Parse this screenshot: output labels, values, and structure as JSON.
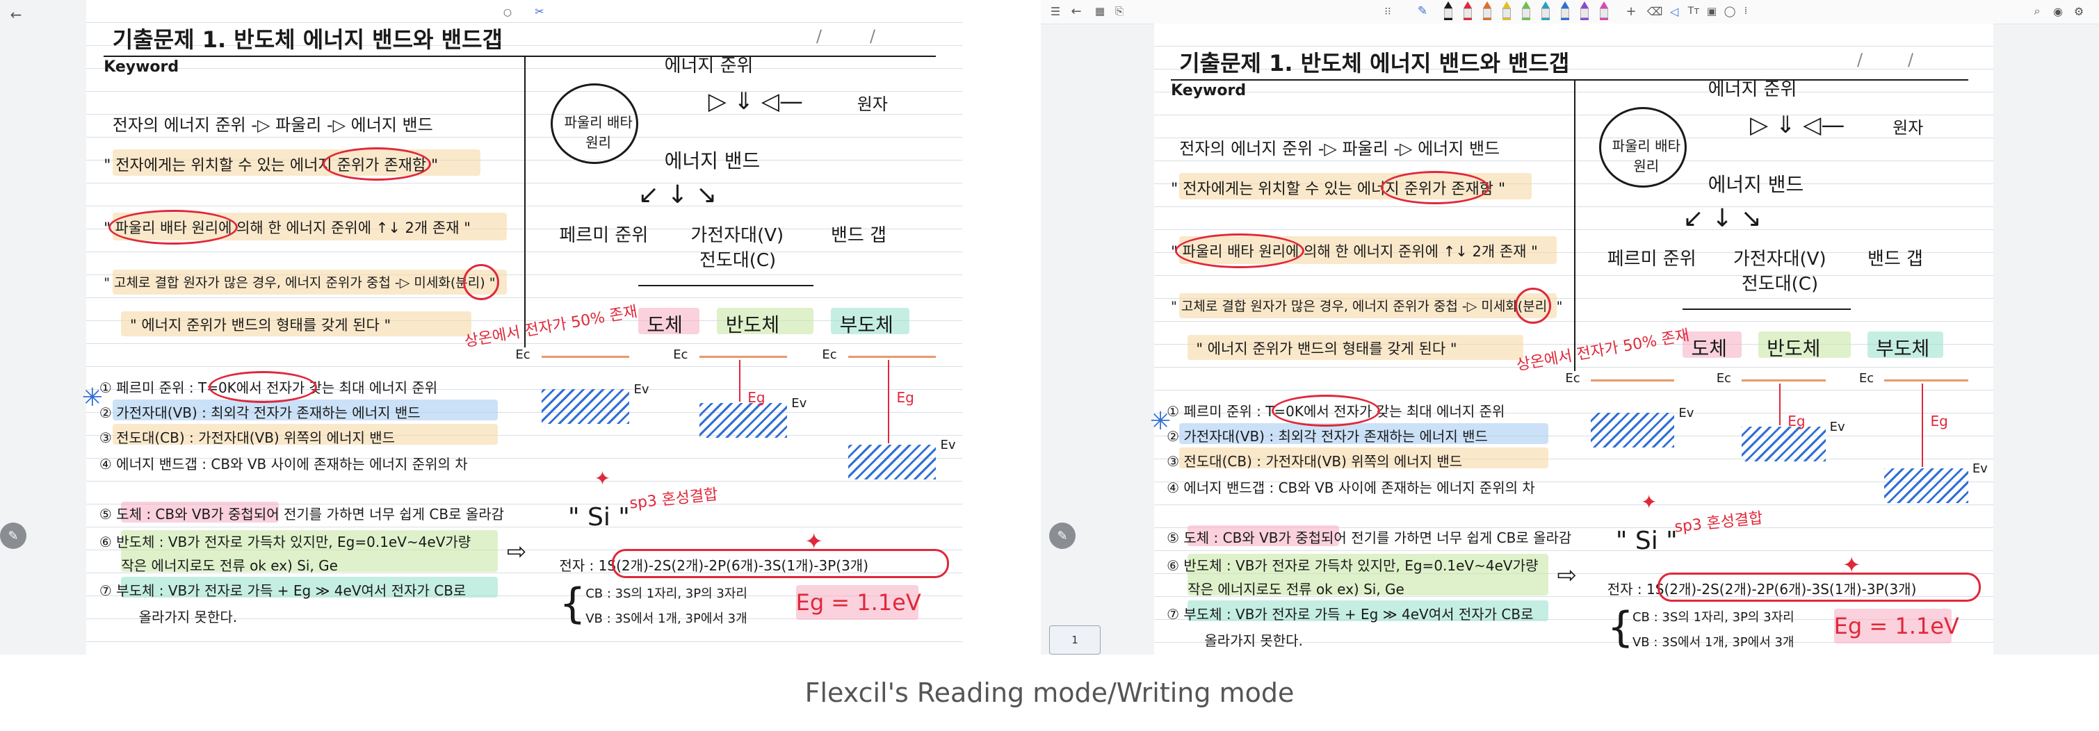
{
  "reading": {
    "pager": {
      "current": "/",
      "total": "/"
    }
  },
  "writing": {
    "pager": {
      "current": "/",
      "total": "/"
    },
    "page_number": "1"
  },
  "note": {
    "title": "기출문제 1. 반도체 에너지 밴드와 밴드갭",
    "keyword": "Keyword",
    "energy_level": "에너지 준위",
    "atom": "원자",
    "pauli": "파울리 배타원리",
    "energy_band": "에너지 밴드",
    "fermi": "페르미 준위",
    "valence_band": "가전자대(V)",
    "conduction_band": "전도대(C)",
    "band_gap": "밴드 갭",
    "line1": "전자의 에너지 준위 -▷ 파울리 -▷ 에너지 밴드",
    "line2": "\" 전자에게는 위치할 수 있는 에너지 준위가 존재함 \"",
    "line3": "\" 파울리 배타 원리에 의해 한 에너지 준위에 ↑↓ 2개 존재 \"",
    "line4": "\" 고체로 결합 원자가 많은 경우, 에너지 준위가 중첩 -▷ 미세화(분리) \"",
    "line5": "\" 에너지 준위가 밴드의 형태를 갖게 된다 \"",
    "cond": "도체",
    "semi": "반도체",
    "insul": "부도체",
    "red_note": "상온에서 전자가 50% 존재",
    "item1": "① 페르미 준위 : T=0K에서 전자가 갖는 최대 에너지 준위",
    "item2": "② 가전자대(VB) : 최외각 전자가 존재하는 에너지 밴드",
    "item3": "③ 전도대(CB) : 가전자대(VB) 위쪽의 에너지 밴드",
    "item4": "④ 에너지 밴드갭 : CB와 VB 사이에 존재하는 에너지 준위의 차",
    "item5": "⑤ 도체 : CB와 VB가 중첩되어 전기를 가하면 너무 쉽게 CB로 올라감",
    "item6a": "⑥ 반도체 : VB가 전자로 가득차 있지만, Eg=0.1eV~4eV가량",
    "item6b": "작은 에너지로도 전류 ok   ex) Si, Ge",
    "item7a": "⑦ 부도체 : VB가 전자로 가득 + Eg ≫ 4eV여서 전자가 CB로",
    "item7b": "올라가지 못한다.",
    "si": "\" Si \"",
    "sp3": "sp3 혼성결합",
    "config": "전자 : 1S(2개)-2S(2개)-2P(6개)-3S(1개)-3P(3개)",
    "cb_note": "CB : 3S의 1자리, 3P의 3자리",
    "vb_note": "VB : 3S에서 1개, 3P에서 3개",
    "eg_value": "Eg = 1.1eV",
    "ec": "Ec",
    "ev": "Ev",
    "eg": "Eg"
  },
  "caption": "Flexcil's Reading mode/Writing mode",
  "colors": {
    "ink": "#1a1a1a",
    "red_ink": "#e0283a",
    "blue_ink": "#2f6fd6",
    "hl_orange": "#f7d9a6",
    "hl_pink": "#f6b3c6",
    "hl_green": "#c8e7a6",
    "hl_mint": "#9fe3cf",
    "hl_blue": "#a9cdf2"
  }
}
